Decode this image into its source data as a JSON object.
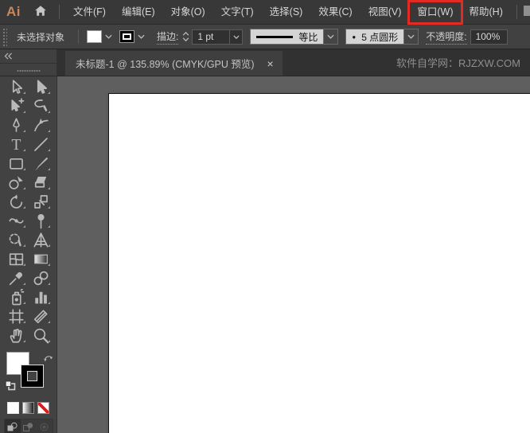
{
  "titlebar": {
    "logo_text": "Ai",
    "menus": [
      "文件(F)",
      "编辑(E)",
      "对象(O)",
      "文字(T)",
      "选择(S)",
      "效果(C)",
      "视图(V)",
      "窗口(W)",
      "帮助(H)"
    ],
    "highlighted_menu": "窗口(W)",
    "highlight_color": "#e32b24"
  },
  "control_bar": {
    "status_text": "未选择对象",
    "fill_swatch_color": "#ffffff",
    "stroke_swatch_color": "#000000",
    "stroke_label": "描边:",
    "stroke_width_value": "1 pt",
    "profile_value": "等比",
    "brush_bullet": "●",
    "brush_value": "5 点圆形",
    "opacity_label": "不透明度:",
    "opacity_value": "100%"
  },
  "tab_bar": {
    "document_tab_title": "未标题-1 @ 135.89% (CMYK/GPU 预览)",
    "close_glyph": "×",
    "watermark": "软件自学网：RJZXW.COM"
  },
  "toolbar": {
    "tools": [
      "selection-tool",
      "direct-selection-tool",
      "group-selection-tool",
      "lasso-tool",
      "pen-tool",
      "curvature-tool",
      "type-tool",
      "line-segment-tool",
      "rectangle-tool",
      "paintbrush-tool",
      "shape-builder-tool",
      "eraser-tool",
      "rotate-tool",
      "scale-tool",
      "width-tool",
      "puppet-warp-tool",
      "perspective-selection-tool",
      "perspective-grid-tool",
      "mesh-tool",
      "gradient-tool",
      "eyedropper-tool",
      "blend-tool",
      "symbol-sprayer-tool",
      "column-graph-tool",
      "artboard-tool",
      "slice-tool",
      "hand-tool",
      "zoom-tool"
    ],
    "fill_color": "#ffffff",
    "stroke_color": "#000000"
  },
  "colors": {
    "accent_red": "#e32b24",
    "pasteboard": "#5f5f5f",
    "artboard": "#ffffff",
    "panel": "#424242"
  }
}
